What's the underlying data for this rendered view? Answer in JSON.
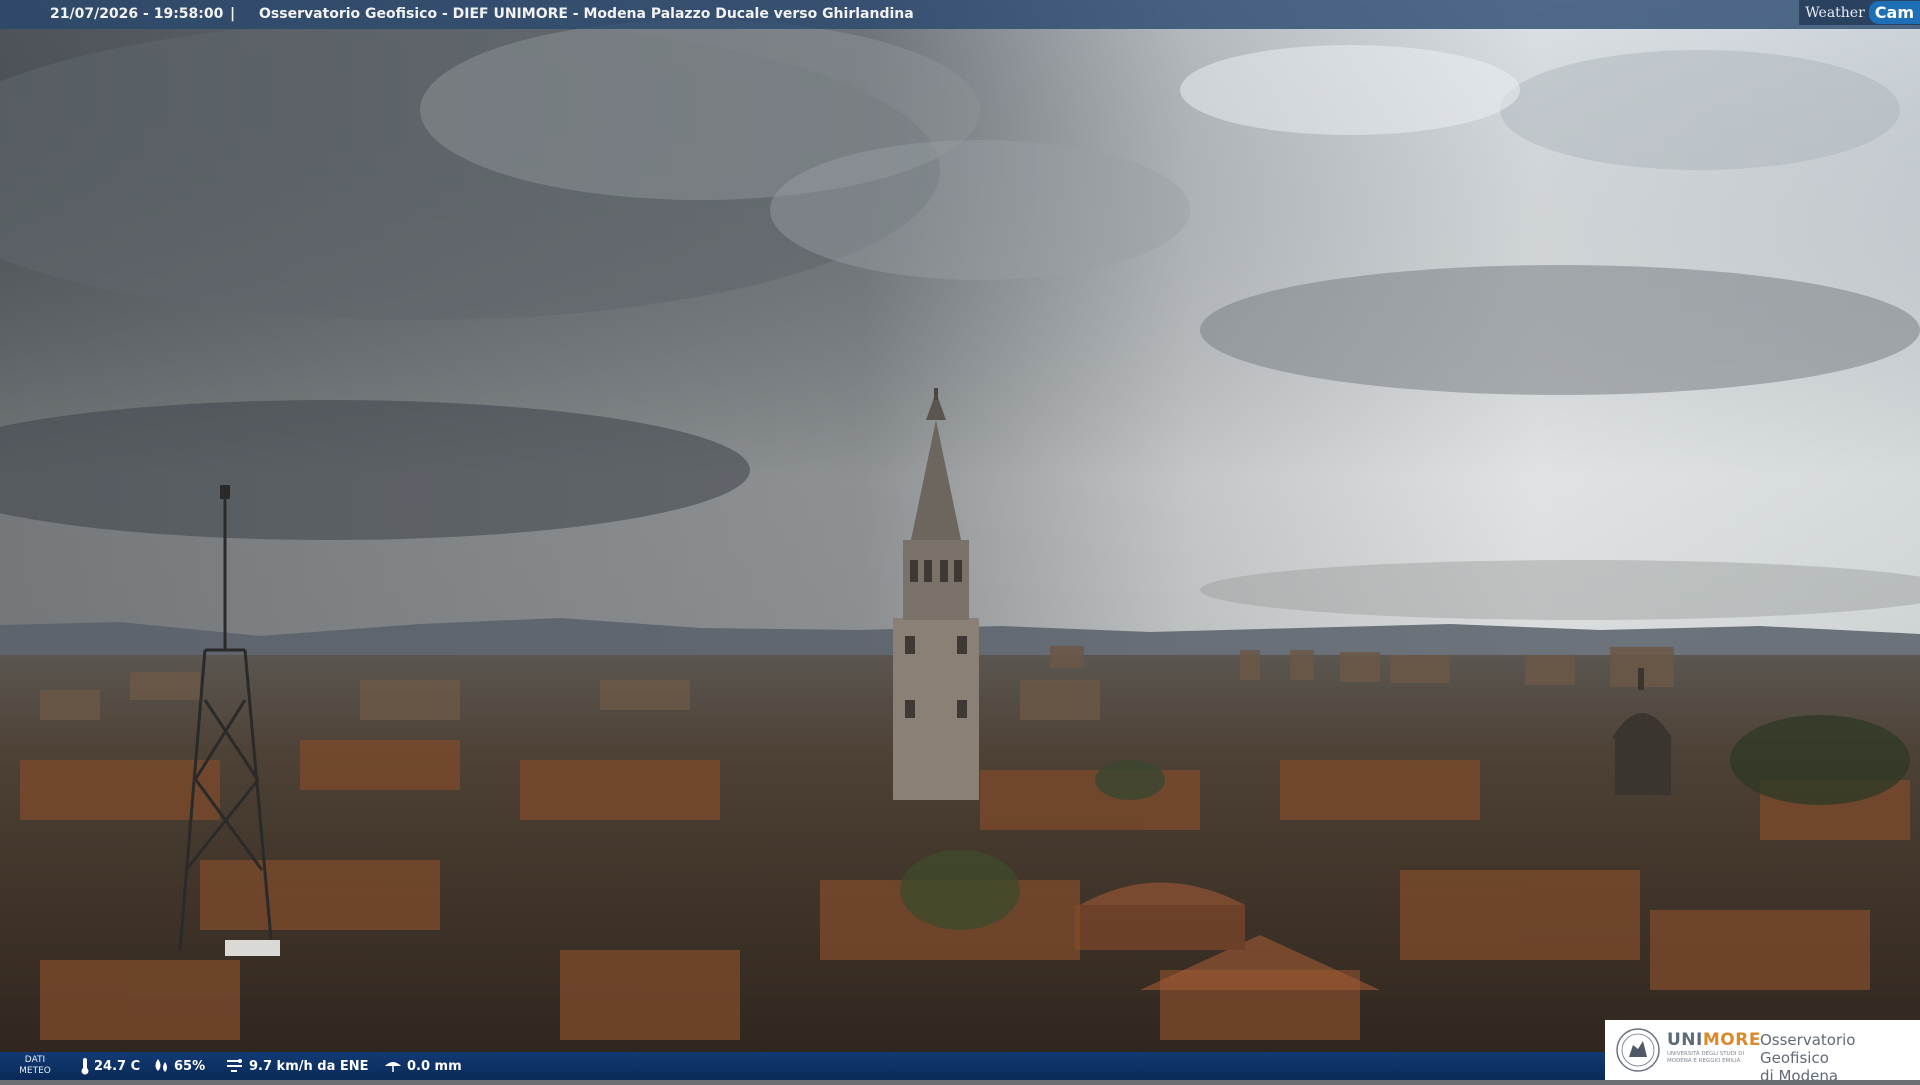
{
  "overlay": {
    "timestamp": "21/07/2026 - 19:58:00",
    "separator": "|",
    "title": "Osservatorio Geofisico - DIEF UNIMORE - Modena Palazzo Ducale verso Ghirlandina"
  },
  "brand": {
    "weather": "Weather",
    "cam": "Cam"
  },
  "weather_data": {
    "label_line1": "DATI",
    "label_line2": "METEO",
    "temperature": "24.7 C",
    "humidity": "65%",
    "wind": "9.7 km/h da ENE",
    "rain": "0.0 mm"
  },
  "logo": {
    "unimore_a": "UNI",
    "unimore_b": "MORE",
    "unimore_sub": "UNIVERSITÀ DEGLI STUDI DI MODENA E REGGIO EMILIA",
    "observatory_line1": "Osservatorio Geofisico",
    "observatory_line2": "di Modena"
  },
  "colors": {
    "bar_blue": "#123a73",
    "accent_orange": "#d98a2a",
    "cam_blue": "#1f6fb6"
  }
}
